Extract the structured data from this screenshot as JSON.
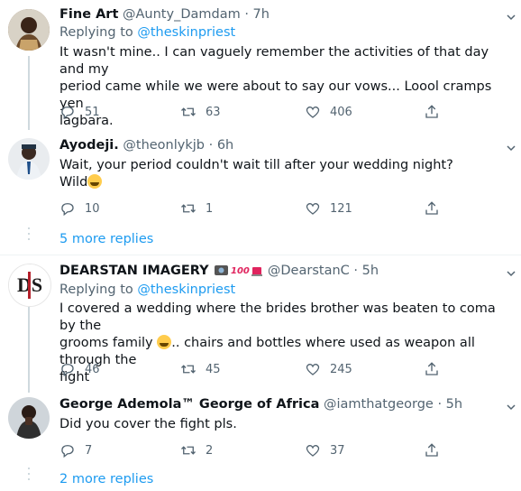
{
  "tweets": [
    {
      "name": "Fine Art",
      "handle": "@Aunty_Damdam",
      "time": "7h",
      "replying_label": "Replying to",
      "replying_to": "@theskinpriest",
      "text_lines": [
        "It wasn't mine.. I can vaguely remember the activities of that day and my",
        "period came while we were about to say our vows... Loool cramps yen",
        "lagbara."
      ],
      "replies": "51",
      "retweets": "63",
      "likes": "406"
    },
    {
      "name": "Ayodeji.",
      "handle": "@theonlykjb",
      "time": "6h",
      "text_lines": [
        "Wait, your period couldn't wait till after your wedding night?",
        "Wild"
      ],
      "replies": "10",
      "retweets": "1",
      "likes": "121"
    },
    {
      "name": "DEARSTAN IMAGERY",
      "handle": "@DearstanC",
      "time": "5h",
      "replying_label": "Replying to",
      "replying_to": "@theskinpriest",
      "avatar_text": "DS",
      "text_lines": [
        "I covered a wedding where the brides brother was beaten to coma by the",
        "grooms family",
        ".. chairs and bottles where used as weapon all through the",
        "fight"
      ],
      "replies": "46",
      "retweets": "45",
      "likes": "245"
    },
    {
      "name": "George Ademola™ George of Africa",
      "handle": "@iamthatgeorge",
      "time": "5h",
      "text_lines": [
        "Did you cover the fight pls."
      ],
      "replies": "7",
      "retweets": "2",
      "likes": "37"
    }
  ],
  "more_replies_1": "5 more replies",
  "more_replies_2": "2 more replies",
  "separator": "·"
}
